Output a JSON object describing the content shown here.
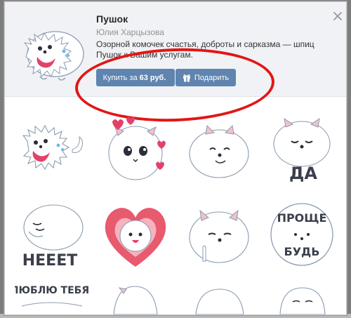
{
  "pack": {
    "title": "Пушок",
    "author": "Юлия Харцызова",
    "description": "Озорной комочек счастья, доброты и сарказма — шпиц Пушок к Вашим услугам."
  },
  "buttons": {
    "buy_prefix": "Купить за",
    "buy_price": "63 руб.",
    "gift_label": "Подарить"
  },
  "stickers": {
    "captions": {
      "yes": "ДА",
      "no": "НЕЕЕТ",
      "simpler": "ПРОЩЕ",
      "be": "БУДЬ",
      "love": "ЛЮБЛЮ ТЕБЯ"
    }
  },
  "colors": {
    "accent": "#5f84af",
    "annotation": "#e21616",
    "header_bg": "#f0f2f5"
  },
  "icons": [
    "close-icon",
    "gift-icon"
  ]
}
